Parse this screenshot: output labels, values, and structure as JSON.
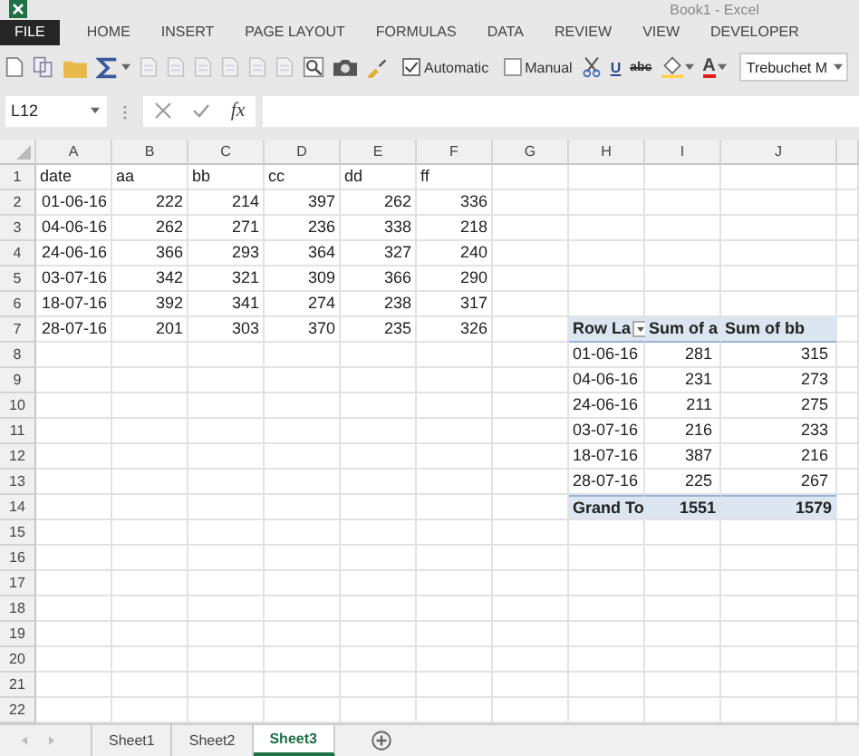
{
  "window": {
    "title": "Book1 - Excel"
  },
  "ribbon_tabs": [
    {
      "label": "FILE",
      "kind": "file",
      "selected": false
    },
    {
      "label": "HOME",
      "kind": "tab",
      "selected": false
    },
    {
      "label": "INSERT",
      "kind": "tab",
      "selected": false
    },
    {
      "label": "PAGE LAYOUT",
      "kind": "tab",
      "selected": false
    },
    {
      "label": "FORMULAS",
      "kind": "tab",
      "selected": false
    },
    {
      "label": "DATA",
      "kind": "tab",
      "selected": false
    },
    {
      "label": "REVIEW",
      "kind": "tab",
      "selected": false
    },
    {
      "label": "VIEW",
      "kind": "tab",
      "selected": false
    },
    {
      "label": "DEVELOPER",
      "kind": "tab",
      "selected": false
    }
  ],
  "toolbar": {
    "checkboxes": [
      {
        "label": "Automatic",
        "checked": true
      },
      {
        "label": "Manual",
        "checked": false
      }
    ],
    "underline": "U",
    "strikethrough": "abc",
    "font_color": "A",
    "font_name": "Trebuchet M"
  },
  "formula_bar": {
    "name_box": "L12",
    "function_label": "fx"
  },
  "sheet": {
    "columns": [
      "A",
      "B",
      "C",
      "D",
      "E",
      "F",
      "G",
      "H",
      "I",
      "J"
    ],
    "row_numbers": [
      "1",
      "2",
      "3",
      "4",
      "5",
      "6",
      "7",
      "8",
      "9",
      "10",
      "11",
      "12",
      "13",
      "14",
      "15",
      "16",
      "17",
      "18",
      "19",
      "20",
      "21",
      "22"
    ]
  },
  "data_table": {
    "header": [
      "date",
      "aa",
      "bb",
      "cc",
      "dd",
      "ff"
    ],
    "rows": [
      [
        "01-06-16",
        "222",
        "214",
        "397",
        "262",
        "336"
      ],
      [
        "04-06-16",
        "262",
        "271",
        "236",
        "338",
        "218"
      ],
      [
        "24-06-16",
        "366",
        "293",
        "364",
        "327",
        "240"
      ],
      [
        "03-07-16",
        "342",
        "321",
        "309",
        "366",
        "290"
      ],
      [
        "18-07-16",
        "392",
        "341",
        "274",
        "238",
        "317"
      ],
      [
        "28-07-16",
        "201",
        "303",
        "370",
        "235",
        "326"
      ]
    ]
  },
  "pivot": {
    "header": [
      "Row La",
      "Sum of a",
      "Sum of bb"
    ],
    "rows": [
      [
        "01-06-16",
        "281",
        "315"
      ],
      [
        "04-06-16",
        "231",
        "273"
      ],
      [
        "24-06-16",
        "211",
        "275"
      ],
      [
        "03-07-16",
        "216",
        "233"
      ],
      [
        "18-07-16",
        "387",
        "216"
      ],
      [
        "28-07-16",
        "225",
        "267"
      ]
    ],
    "grand_total": [
      "Grand To",
      "1551",
      "1579"
    ]
  },
  "sheet_tabs": [
    {
      "label": "Sheet1",
      "selected": false
    },
    {
      "label": "Sheet2",
      "selected": false
    },
    {
      "label": "Sheet3",
      "selected": true
    }
  ]
}
